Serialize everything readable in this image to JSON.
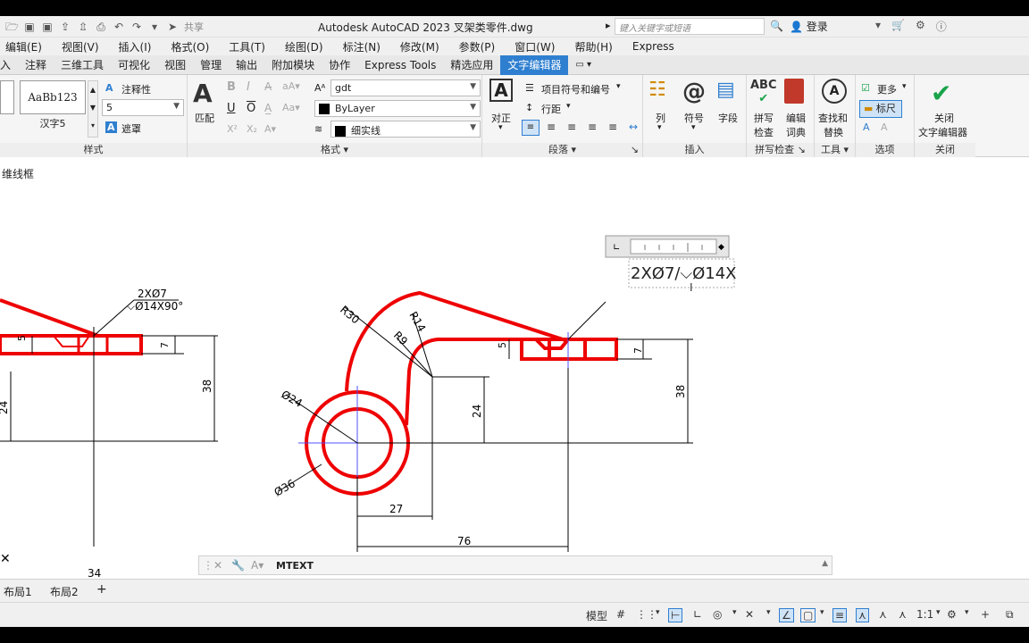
{
  "window": {
    "title": "Autodesk AutoCAD 2023    叉架类零件.dwg",
    "share_label": "共享",
    "search_placeholder": "键入关键字或短语",
    "login_label": "登录"
  },
  "menu": [
    "编辑(E)",
    "视图(V)",
    "插入(I)",
    "格式(O)",
    "工具(T)",
    "绘图(D)",
    "标注(N)",
    "修改(M)",
    "参数(P)",
    "窗口(W)",
    "帮助(H)",
    "Express"
  ],
  "tabs": [
    "入",
    "注释",
    "三维工具",
    "可视化",
    "视图",
    "管理",
    "输出",
    "附加模块",
    "协作",
    "Express Tools",
    "精选应用",
    "文字编辑器"
  ],
  "active_tab": "文字编辑器",
  "ribbon": {
    "style": {
      "preview_text": "AaBb123",
      "style_name": "汉字5",
      "annotative": "注释性",
      "height_value": "5",
      "mask": "遮罩",
      "title": "样式"
    },
    "format": {
      "match": "匹配",
      "bold": "B",
      "italic": "I",
      "underline": "U",
      "overline": "O",
      "font": "gdt",
      "color": "ByLayer",
      "linetype": "细实线",
      "title": "格式"
    },
    "paragraph": {
      "justify": "对正",
      "bullets": "项目符号和编号",
      "line_spacing": "行距",
      "title": "段落"
    },
    "insert": {
      "columns": "列",
      "symbol": "符号",
      "field": "字段",
      "title": "插入"
    },
    "spell": {
      "check_1": "拼写",
      "check_2": "检查",
      "edit_1": "编辑",
      "edit_2": "词典",
      "title": "拼写检查"
    },
    "tools": {
      "find_1": "查找和",
      "find_2": "替换",
      "title": "工具"
    },
    "options": {
      "more": "更多",
      "ruler": "标尺",
      "title": "选项"
    },
    "close": {
      "label_1": "关闭",
      "label_2": "文字编辑器",
      "title": "关闭"
    }
  },
  "viewport_label": "维线框",
  "drawing": {
    "left_note_1": "2XØ7",
    "left_note_2": "⌵Ø14X90°",
    "left_dim_5": "5",
    "left_dim_7": "7",
    "left_dim_38": "38",
    "left_dim_24": "24",
    "left_dim_34": "34",
    "r30": "R30",
    "r14": "R14",
    "r9": "R9",
    "d24": "Ø24",
    "d36": "Ø36",
    "dim_5": "5",
    "dim_7": "7",
    "dim_38": "38",
    "dim_24": "24",
    "dim_27": "27",
    "dim_76": "76",
    "mtext_value": "2XØ7/⌵Ø14X"
  },
  "command": {
    "text": "MTEXT"
  },
  "layouts": [
    "布局1",
    "布局2",
    "+"
  ],
  "status": {
    "model": "模型",
    "scale": "1:1"
  }
}
